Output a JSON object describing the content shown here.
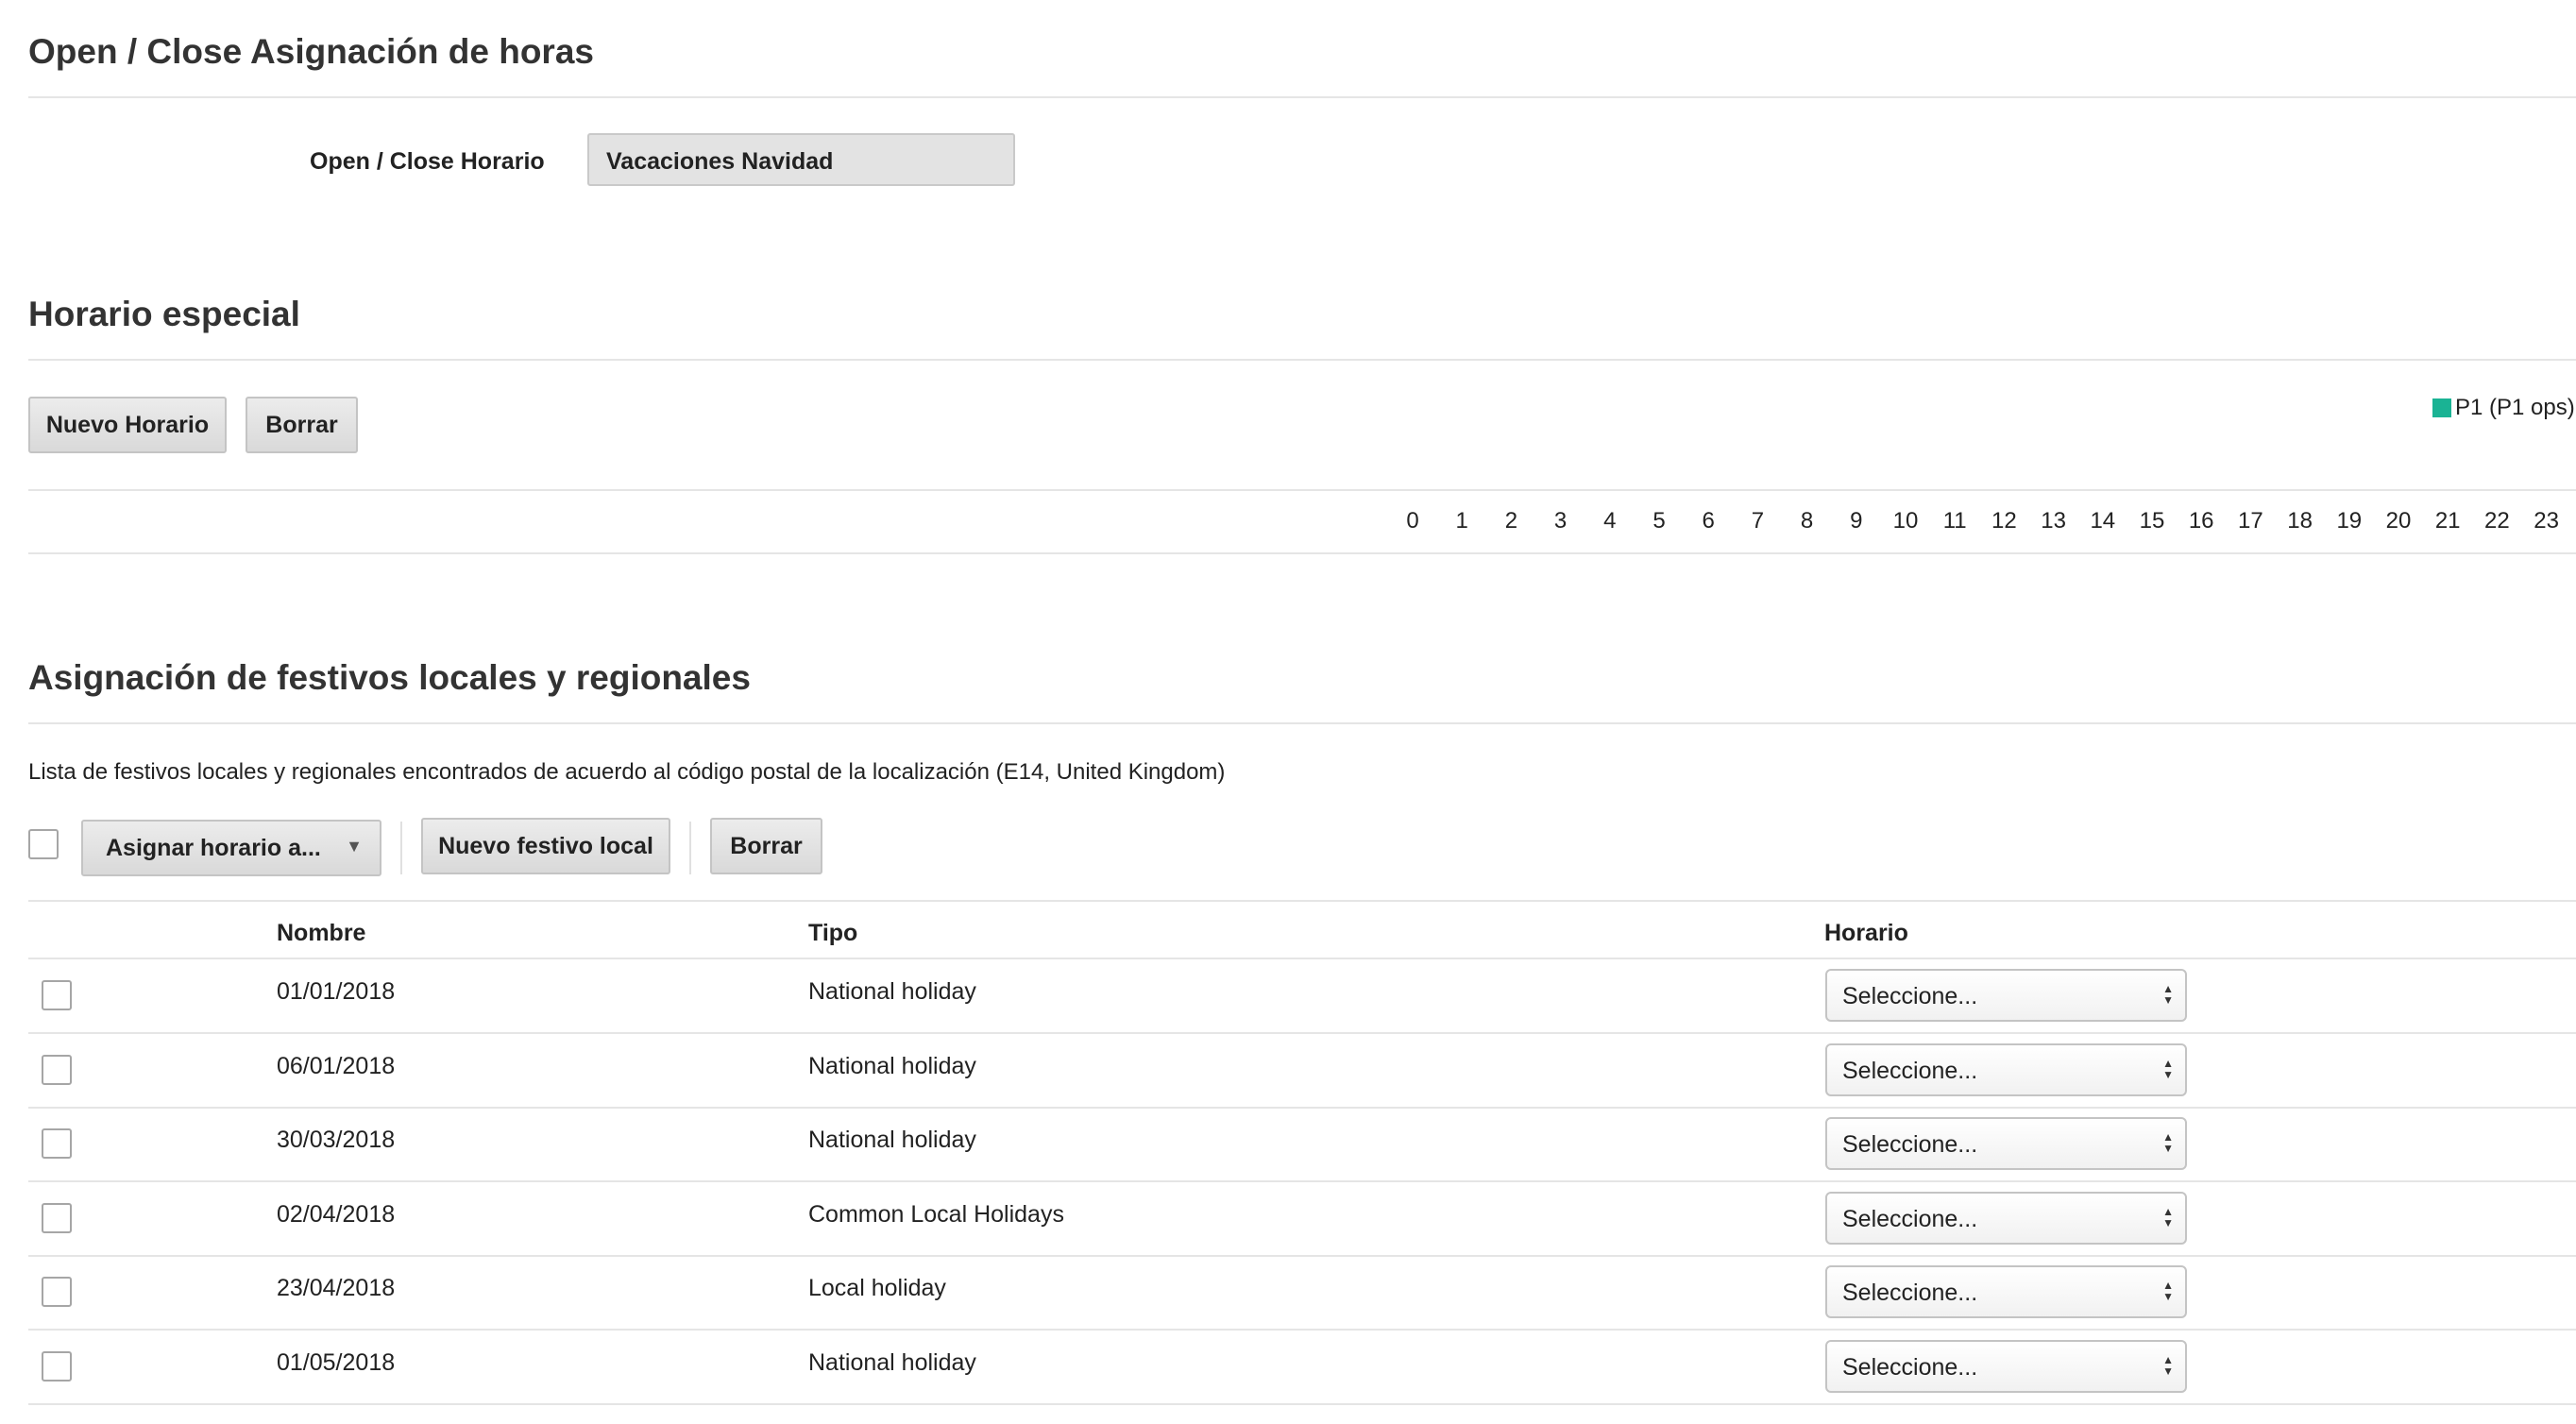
{
  "open_close": {
    "title": "Open / Close Asignación de horas",
    "label": "Open / Close Horario",
    "value": "Vacaciones Navidad"
  },
  "horario_especial": {
    "title": "Horario especial",
    "new_button": "Nuevo Horario",
    "delete_button": "Borrar",
    "legend": "P1 (P1 ops)",
    "legend_color": "#1ab394",
    "hours": [
      "0",
      "1",
      "2",
      "3",
      "4",
      "5",
      "6",
      "7",
      "8",
      "9",
      "10",
      "11",
      "12",
      "13",
      "14",
      "15",
      "16",
      "17",
      "18",
      "19",
      "20",
      "21",
      "22",
      "23"
    ]
  },
  "festivos": {
    "title": "Asignación de festivos locales y regionales",
    "description": "Lista de festivos locales y regionales encontrados de acuerdo al código postal de la localización (E14, United Kingdom)",
    "assign_dropdown": "Asignar horario a...",
    "new_button": "Nuevo festivo local",
    "delete_button": "Borrar",
    "columns": {
      "name": "Nombre",
      "type": "Tipo",
      "schedule": "Horario"
    },
    "rows": [
      {
        "name": "01/01/2018",
        "type": "National holiday",
        "schedule": "Seleccione..."
      },
      {
        "name": "06/01/2018",
        "type": "National holiday",
        "schedule": "Seleccione..."
      },
      {
        "name": "30/03/2018",
        "type": "National holiday",
        "schedule": "Seleccione..."
      },
      {
        "name": "02/04/2018",
        "type": "Common Local Holidays",
        "schedule": "Seleccione..."
      },
      {
        "name": "23/04/2018",
        "type": "Local holiday",
        "schedule": "Seleccione..."
      },
      {
        "name": "01/05/2018",
        "type": "National holiday",
        "schedule": "Seleccione..."
      }
    ]
  }
}
